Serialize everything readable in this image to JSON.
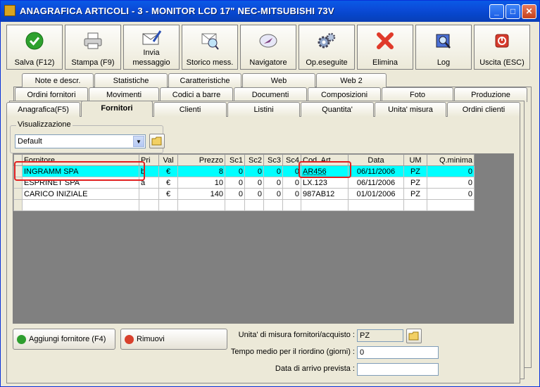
{
  "window": {
    "title": "ANAGRAFICA ARTICOLI - 3 - MONITOR LCD 17\" NEC-MITSUBISHI 73V",
    "minimize": "_",
    "maximize": "□",
    "close": "✕"
  },
  "toolbar": [
    {
      "label": "Salva (F12)",
      "icon": "check-icon"
    },
    {
      "label": "Stampa (F9)",
      "icon": "printer-icon"
    },
    {
      "label": "Invia messaggio",
      "label_line1": "Invia",
      "label_line2": "messaggio",
      "icon": "envelope-pen-icon"
    },
    {
      "label": "Storico mess.",
      "icon": "mail-search-icon"
    },
    {
      "label": "Navigatore",
      "icon": "compass-icon"
    },
    {
      "label": "Op.eseguite",
      "icon": "gears-icon"
    },
    {
      "label": "Elimina",
      "icon": "red-x-icon"
    },
    {
      "label": "Log",
      "icon": "log-search-icon"
    },
    {
      "label": "Uscita (ESC)",
      "icon": "exit-icon"
    }
  ],
  "tabs_row1": [
    "Note e descr.",
    "Statistiche",
    "Caratteristiche",
    "Web",
    "Web 2"
  ],
  "tabs_row2": [
    "Ordini fornitori",
    "Movimenti",
    "Codici a barre",
    "Documenti",
    "Composizioni",
    "Foto",
    "Produzione"
  ],
  "tabs_row3": [
    "Anagrafica(F5)",
    "Fornitori",
    "Clienti",
    "Listini",
    "Quantita'",
    "Unita' misura",
    "Ordini clienti"
  ],
  "active_tab": "Fornitori",
  "view": {
    "label": "Visualizzazione",
    "selected": "Default"
  },
  "grid": {
    "columns": [
      "Fornitore",
      "Pri",
      "Val",
      "Prezzo",
      "Sc1",
      "Sc2",
      "Sc3",
      "Sc4",
      "Cod. Art",
      "Data",
      "UM",
      "Q.minima"
    ],
    "rows": [
      [
        "INGRAMM SPA",
        "b",
        "€",
        "8",
        "0",
        "0",
        "0",
        "0",
        "AR456",
        "06/11/2006",
        "PZ",
        "0"
      ],
      [
        "ESPRINET SPA",
        "a",
        "€",
        "10",
        "0",
        "0",
        "0",
        "0",
        "LX.123",
        "06/11/2006",
        "PZ",
        "0"
      ],
      [
        "CARICO INIZIALE",
        "",
        "€",
        "140",
        "0",
        "0",
        "0",
        "0",
        "987AB12",
        "01/01/2006",
        "PZ",
        "0"
      ]
    ]
  },
  "buttons": {
    "add_supplier": "Aggiungi fornitore (F4)",
    "remove": "Rimuovi"
  },
  "fields": {
    "unit_label": "Unita' di misura fornitori/acquisto :",
    "unit_value": "PZ",
    "reorder_label": "Tempo medio per il riordino (giorni) :",
    "reorder_value": "0",
    "arrival_label": "Data di arrivo prevista :",
    "arrival_value": ""
  },
  "colors": {
    "selected_row": "#00ffff",
    "highlight": "#e02020",
    "titlebar": "#0a5ae6"
  }
}
